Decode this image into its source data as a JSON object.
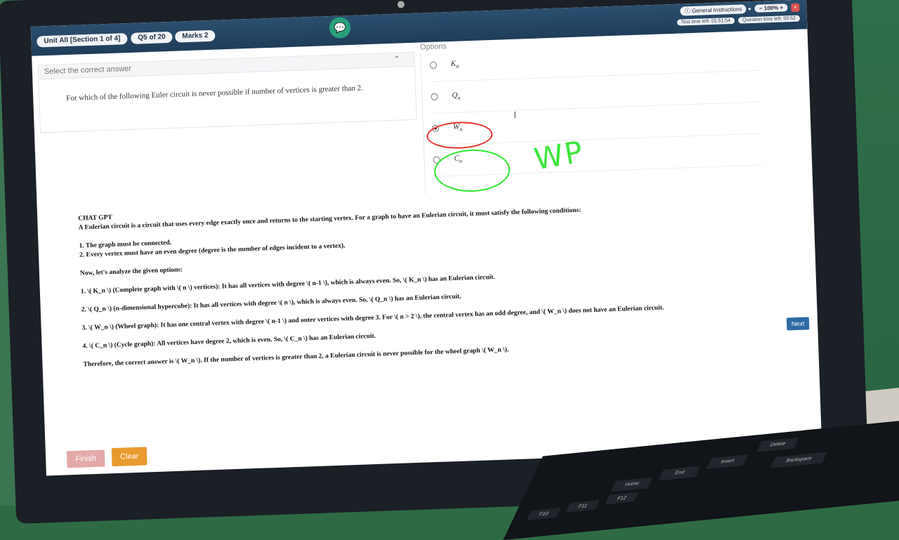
{
  "exam": {
    "section": "Unit All [Section 1 of 4]",
    "question_counter": "Q5 of 20",
    "marks": "Marks 2",
    "general_instructions": "General Instructions",
    "zoom": "100%",
    "test_time_left": "Test time left: 01:51:54",
    "question_time_left": "Question time left: 00:52"
  },
  "question": {
    "header": "Select the correct answer",
    "text": "For which of the following Euler circuit is never possible if number of vertices is greater than 2."
  },
  "options": {
    "header": "Options",
    "items": [
      {
        "base": "K",
        "sub": "n",
        "selected": false
      },
      {
        "base": "Q",
        "sub": "n",
        "selected": false
      },
      {
        "base": "W",
        "sub": "n",
        "selected": true
      },
      {
        "base": "C",
        "sub": "n",
        "selected": false
      }
    ]
  },
  "annotation": {
    "handwritten": "WP"
  },
  "answer": {
    "heading": "CHAT GPT",
    "intro": "A Eulerian circuit is a circuit that uses every edge exactly once and returns to the starting vertex. For a graph to have an Eulerian circuit, it must satisfy the following conditions:",
    "cond1": "1. The graph must be connected.",
    "cond2": "2. Every vertex must have an even degree (degree is the number of edges incident to a vertex).",
    "analyze": "Now, let's analyze the given options:",
    "opt1": "1. \\( K_n \\) (Complete graph with \\( n \\) vertices): It has all vertices with degree \\( n-1 \\), which is always even. So, \\( K_n \\) has an Eulerian circuit.",
    "opt2": "2. \\( Q_n \\) (n-dimensional hypercube): It has all vertices with degree \\( n \\), which is always even. So, \\( Q_n \\) has an Eulerian circuit.",
    "opt3": "3. \\( W_n \\) (Wheel graph): It has one central vertex with degree \\( n-1 \\) and outer vertices with degree 3. For \\( n > 2 \\), the central vertex has an odd degree, and \\( W_n \\) does not have an Eulerian circuit.",
    "opt4": "4. \\( C_n \\) (Cycle graph): All vertices have degree 2, which is even. So, \\( C_n \\) has an Eulerian circuit.",
    "conclusion": "Therefore, the correct answer is \\( W_n \\). If the number of vertices is greater than 2, a Eulerian circuit is never possible for the wheel graph \\( W_n \\)."
  },
  "buttons": {
    "next": "Next",
    "finish": "Finish",
    "clear": "Clear"
  },
  "keyboard": {
    "keys": [
      "Delete",
      "Insert",
      "End",
      "Home",
      "Backspace",
      "F10",
      "F11",
      "F12"
    ]
  },
  "colors": {
    "topbar": "#1f3d59",
    "red_mark": "#e8312a",
    "green_mark": "#2ee82e",
    "next": "#2d6aa3",
    "clear": "#e99a2e"
  }
}
